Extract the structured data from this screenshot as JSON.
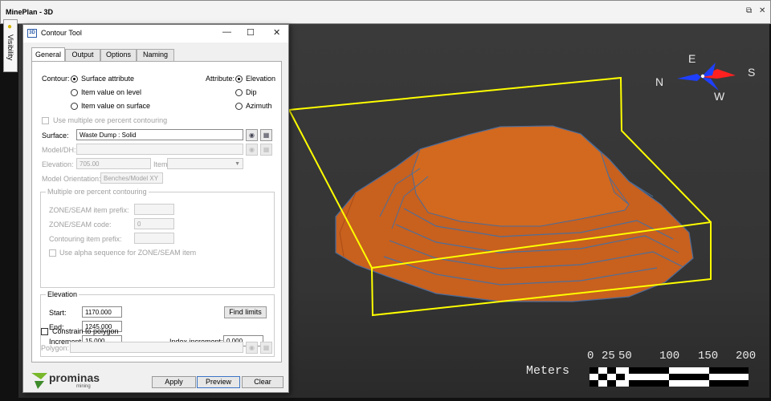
{
  "app": {
    "title": "MinePlan - 3D",
    "restore_glyph": "⧉",
    "close_glyph": "✕"
  },
  "visibility": {
    "label": "Visibility",
    "icon": "bulb-icon"
  },
  "dialog": {
    "badge": "3D",
    "title": "Contour Tool",
    "controls": {
      "minimize": "—",
      "maximize": "☐",
      "close": "✕"
    },
    "tabs": [
      "General",
      "Output",
      "Options",
      "Naming"
    ],
    "contour": {
      "label": "Contour:",
      "options": [
        "Surface attribute",
        "Item value on level",
        "Item value on surface"
      ],
      "selected": "Surface attribute"
    },
    "attribute": {
      "label": "Attribute:",
      "options": [
        "Elevation",
        "Dip",
        "Azimuth"
      ],
      "selected": "Elevation"
    },
    "use_multiple_label": "Use multiple ore percent contouring",
    "surface": {
      "label": "Surface:",
      "value": "Waste Dump : Solid"
    },
    "model_dh": {
      "label": "Model/DH:",
      "value": ""
    },
    "elevation_field": {
      "label": "Elevation:",
      "value": "705.00"
    },
    "item": {
      "label": "Item:",
      "value": ""
    },
    "model_orientation": {
      "label": "Model Orientation:",
      "value": "Benches/Model XY"
    },
    "multi_group": {
      "title": "Multiple ore percent contouring",
      "zone_prefix_label": "ZONE/SEAM item prefix:",
      "zone_prefix_value": "",
      "zone_code_label": "ZONE/SEAM code:",
      "zone_code_value": "0",
      "contouring_prefix_label": "Contouring item prefix:",
      "contouring_prefix_value": "",
      "alpha_label": "Use alpha sequence for ZONE/SEAM item"
    },
    "elevation_group": {
      "title": "Elevation",
      "start_label": "Start:",
      "start_value": "1170.000",
      "end_label": "End:",
      "end_value": "1245.000",
      "increment_label": "Increment:",
      "increment_value": "15.000",
      "index_label": "Index increment:",
      "index_value": "0.000",
      "find_limits": "Find limits"
    },
    "constrain_label": "Constrain to polygon",
    "polygon": {
      "label": "Polygon:",
      "value": ""
    },
    "logo": {
      "name": "prominas",
      "sub": "mining"
    },
    "buttons": {
      "apply": "Apply",
      "preview": "Preview",
      "clear": "Clear"
    }
  },
  "compass": {
    "n": "N",
    "e": "E",
    "s": "S",
    "w": "W",
    "colors": {
      "north": "#1f3fff",
      "south": "#ff2020"
    }
  },
  "scale": {
    "label": "Meters",
    "ticks": [
      "0",
      "25",
      "50",
      "100",
      "150",
      "200"
    ]
  },
  "colors": {
    "dump": "#c8601e",
    "bounding_box": "#ffff00",
    "background": "#383838"
  }
}
